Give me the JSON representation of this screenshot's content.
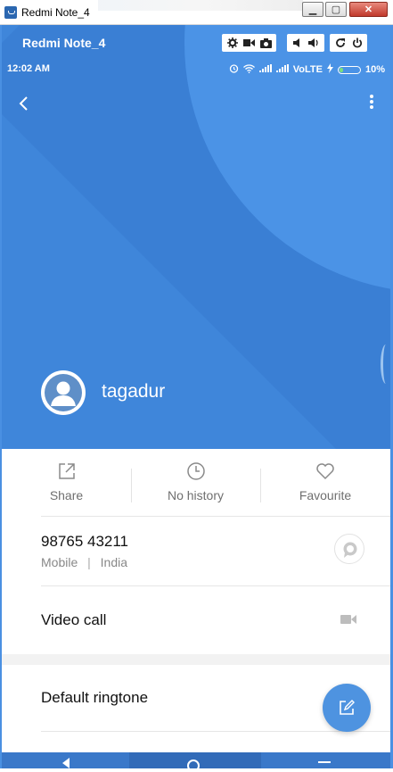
{
  "window": {
    "title": "Redmi Note_4",
    "min_icon": "minimize-icon",
    "max_icon": "maximize-icon",
    "close_icon": "close-icon",
    "min_glyph": "▁",
    "max_glyph": "▢",
    "close_glyph": "✕"
  },
  "emulator": {
    "device_name": "Redmi Note_4",
    "tools": [
      "settings-icon",
      "video-record-icon",
      "camera-icon",
      "volume-down-icon",
      "volume-up-icon",
      "rotate-icon",
      "power-icon"
    ]
  },
  "status_bar": {
    "time": "12:02 AM",
    "network": "VoLTE",
    "battery": "10%",
    "battery_level": 0.1
  },
  "contact": {
    "name": "tagadur"
  },
  "actions": [
    {
      "label": "Share",
      "icon": "share-icon"
    },
    {
      "label": "No history",
      "icon": "clock-icon"
    },
    {
      "label": "Favourite",
      "icon": "heart-icon"
    }
  ],
  "phone": {
    "number": "98765 43211",
    "type": "Mobile",
    "separator": "|",
    "region": "India"
  },
  "video_call": {
    "label": "Video call"
  },
  "ringtone": {
    "label": "Default ringtone"
  },
  "colors": {
    "header_blue": "#3f86da",
    "accent": "#4e93e0"
  }
}
